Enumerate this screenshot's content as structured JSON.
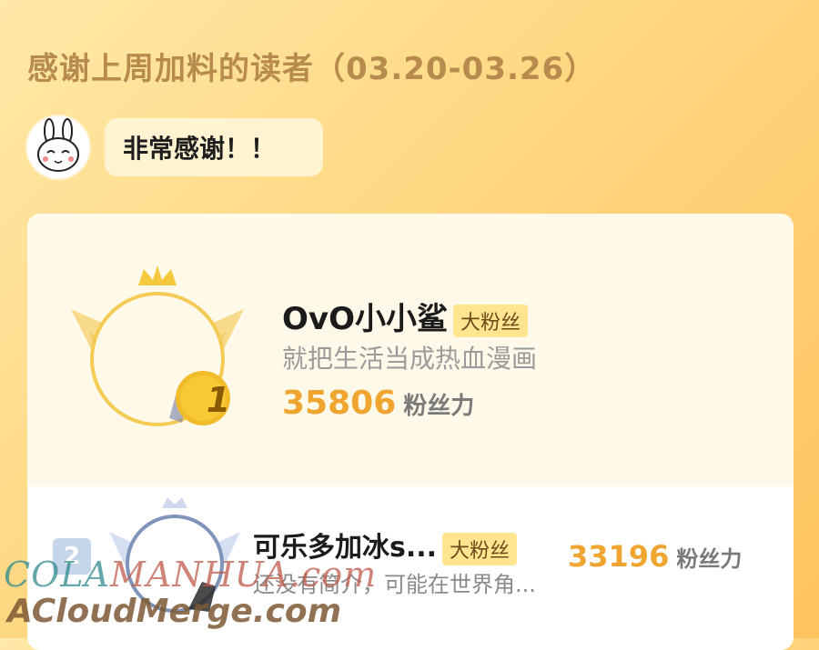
{
  "header": {
    "title": "感谢上周加料的读者（03.20-03.26）"
  },
  "message": {
    "text": "非常感谢！！"
  },
  "leaderboard": [
    {
      "rank": "1",
      "name": "OvO小小鲨",
      "badge": "大粉丝",
      "bio": "就把生活当成热血漫画",
      "score": "35806",
      "score_unit": "粉丝力"
    },
    {
      "rank": "2",
      "name": "可乐多加冰s...",
      "badge": "大粉丝",
      "bio": "还没有简介，可能在世界角...",
      "score": "33196",
      "score_unit": "粉丝力"
    }
  ],
  "watermarks": {
    "line1_a": "COLA",
    "line1_b": "MANHUA.com",
    "line2": "ACloudMerge.com"
  },
  "colors": {
    "accent": "#f0a531",
    "title": "#b78a4d",
    "badge_bg": "#ffe58f"
  }
}
